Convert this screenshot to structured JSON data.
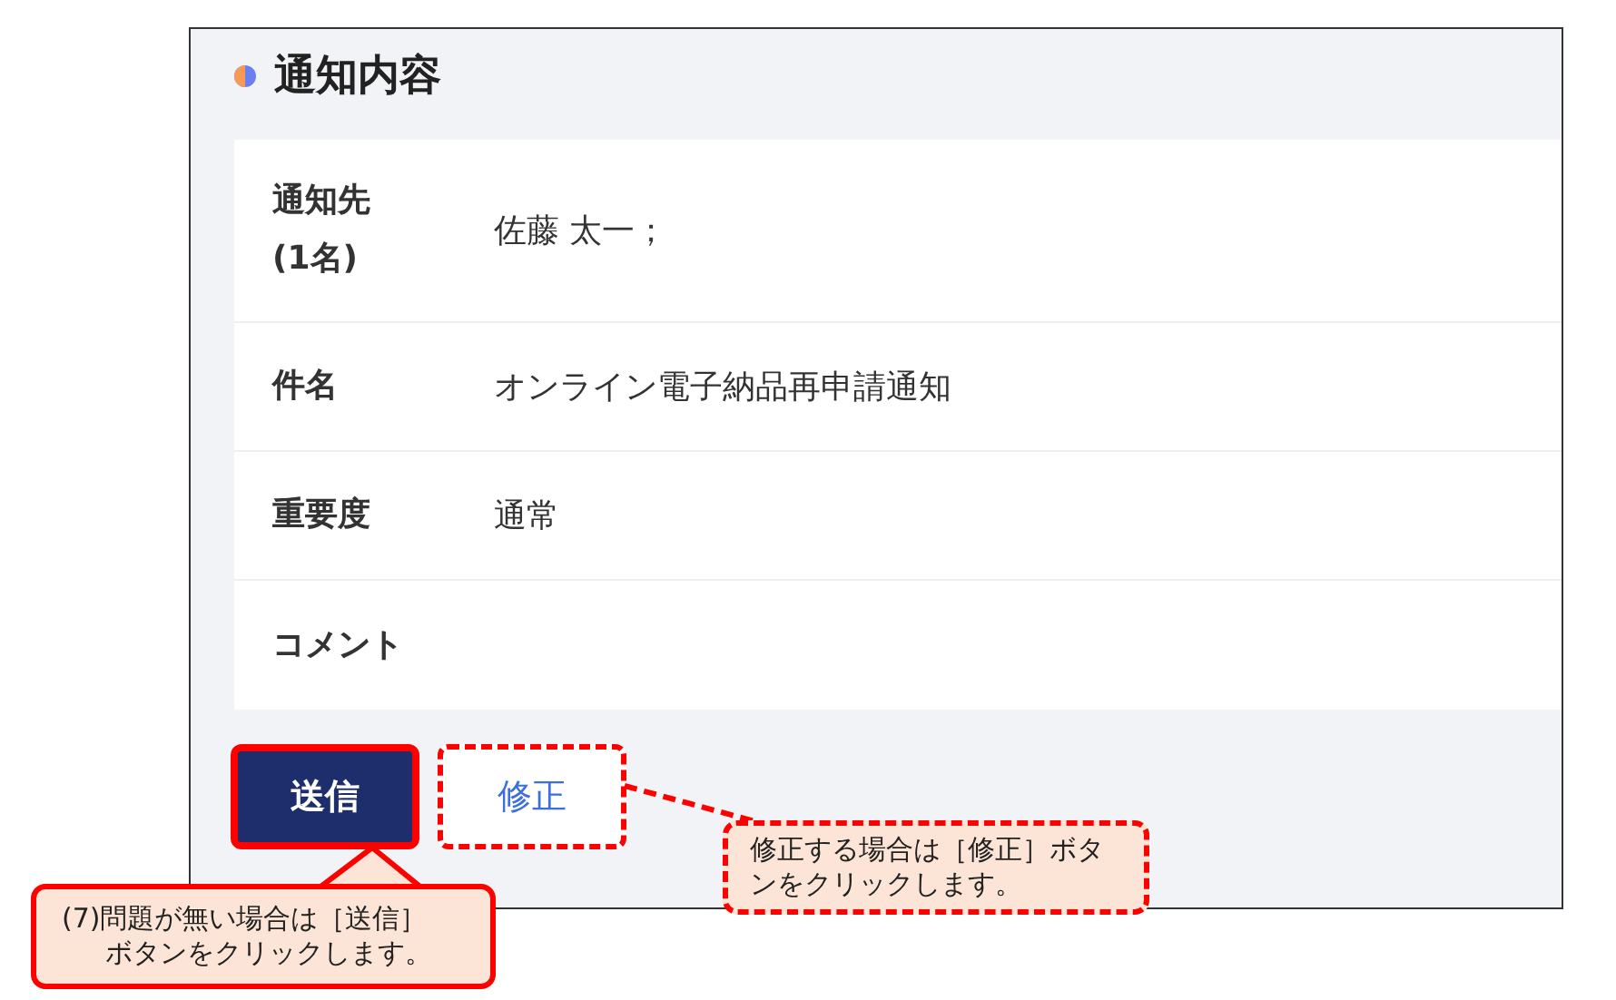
{
  "section": {
    "title": "通知内容"
  },
  "fields": [
    {
      "label_lines": [
        "通知先",
        "(1名)"
      ],
      "value": "佐藤 太一；"
    },
    {
      "label_lines": [
        "件名"
      ],
      "value": "オンライン電子納品再申請通知"
    },
    {
      "label_lines": [
        "重要度"
      ],
      "value": "通常"
    },
    {
      "label_lines": [
        "コメント"
      ]
    }
  ],
  "buttons": [
    {
      "label": "送信",
      "kind": "primary"
    },
    {
      "label": "修正",
      "kind": "secondary"
    }
  ],
  "callouts": [
    {
      "lines": [
        "(7)問題が無い場合は［送信］",
        "ボタンをクリックします。"
      ]
    },
    {
      "lines": [
        "修正する場合は［修正］ボタ",
        "ンをクリックします。"
      ]
    }
  ]
}
